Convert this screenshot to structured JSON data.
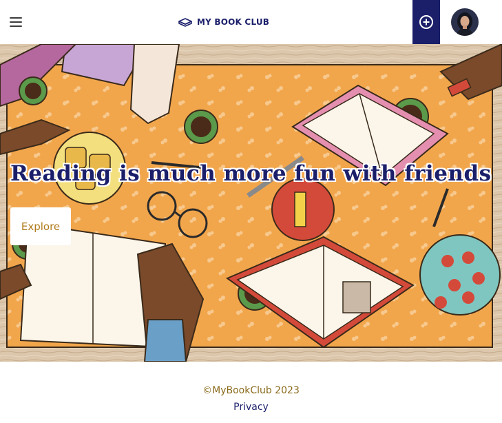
{
  "header": {
    "brand": "MY BOOK CLUB",
    "menu_icon": "hamburger-menu-icon",
    "brand_icon": "books-icon",
    "add_icon": "add-circle-icon"
  },
  "hero": {
    "title": "Reading is much more fun with friends",
    "explore_label": "Explore"
  },
  "footer": {
    "copyright": "©MyBookClub 2023",
    "privacy": "Privacy"
  },
  "colors": {
    "brand_navy": "#1b1f6a",
    "accent_gold": "#b07a1a",
    "table_orange": "#f2a64c"
  }
}
